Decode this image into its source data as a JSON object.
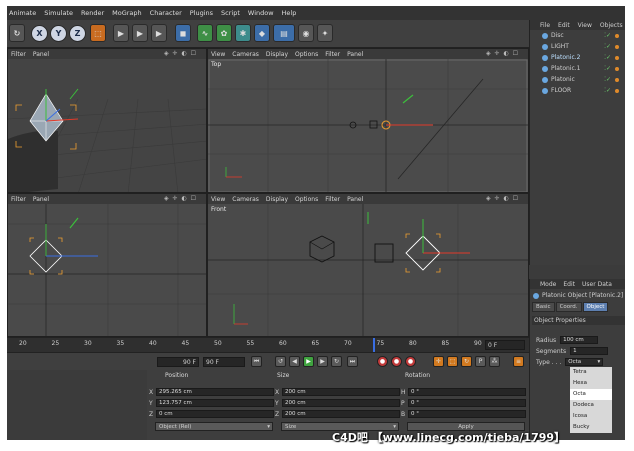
{
  "menubar": {
    "items": [
      "Animate",
      "Simulate",
      "Render",
      "MoGraph",
      "Character",
      "Plugins",
      "Script",
      "Window",
      "Help"
    ]
  },
  "toolbar": {
    "x": "X",
    "y": "Y",
    "z": "Z"
  },
  "viewport_persp": {
    "menu": [
      "Filter",
      "Panel"
    ],
    "controls": "◈ ✛ ◐ ☐"
  },
  "viewport_top": {
    "menu": [
      "View",
      "Cameras",
      "Display",
      "Options",
      "Filter",
      "Panel"
    ],
    "name": "Top",
    "controls": "◈ ✛ ◐ ☐"
  },
  "viewport_right": {
    "menu": [
      "Filter",
      "Panel"
    ],
    "controls": "◈ ✛ ◐ ☐"
  },
  "viewport_front": {
    "menu": [
      "View",
      "Cameras",
      "Display",
      "Options",
      "Filter",
      "Panel"
    ],
    "name": "Front",
    "controls": "◈ ✛ ◐ ☐"
  },
  "object_manager": {
    "menu": [
      "File",
      "Edit",
      "View",
      "Objects"
    ],
    "objects": [
      {
        "name": "Disc",
        "selected": false
      },
      {
        "name": "LIGHT",
        "selected": false
      },
      {
        "name": "Platonic.2",
        "selected": true
      },
      {
        "name": "Platonic.1",
        "selected": false
      },
      {
        "name": "Platonic",
        "selected": false
      },
      {
        "name": "FLOOR",
        "selected": false
      }
    ]
  },
  "attributes": {
    "menu": [
      "Mode",
      "Edit",
      "User Data"
    ],
    "object_title": "Platonic Object [Platonic.2]",
    "tabs": [
      "Basic",
      "Coord.",
      "Object"
    ],
    "active_tab": "Object",
    "section": "Object Properties",
    "radius_label": "Radius",
    "radius_value": "100 cm",
    "segments_label": "Segments",
    "segments_value": "1",
    "type_label": "Type . . .",
    "type_value": "Octa",
    "type_options": [
      "Tetra",
      "Hexa",
      "Octa",
      "Dodeca",
      "Icosa",
      "Bucky"
    ]
  },
  "timeline": {
    "ticks": [
      "20",
      "25",
      "30",
      "35",
      "40",
      "45",
      "50",
      "55",
      "60",
      "65",
      "70",
      "75",
      "80",
      "85",
      "90"
    ],
    "end_frame": "0 F"
  },
  "playbar": {
    "current_frame": "90 F",
    "end_frame": "90 F"
  },
  "coordinates": {
    "headers": {
      "position": "Position",
      "size": "Size",
      "rotation": "Rotation"
    },
    "rows": [
      {
        "axis": "X",
        "pos": "295.265 cm",
        "saxis": "X",
        "size": "200 cm",
        "raxis": "H",
        "rot": "0 °"
      },
      {
        "axis": "Y",
        "pos": "123.757 cm",
        "saxis": "Y",
        "size": "200 cm",
        "raxis": "P",
        "rot": "0 °"
      },
      {
        "axis": "Z",
        "pos": "0 cm",
        "saxis": "Z",
        "size": "200 cm",
        "raxis": "B",
        "rot": "0 °"
      }
    ],
    "mode": "Object (Rel)",
    "size_mode": "Size",
    "apply": "Apply"
  },
  "watermark": "C4D吧 【www.linecg.com/tieba/1799】",
  "colors": {
    "axis_x": "#e23a2a",
    "axis_y": "#3cbf3c",
    "axis_z": "#3a6ee2",
    "selection": "#f0a030"
  }
}
